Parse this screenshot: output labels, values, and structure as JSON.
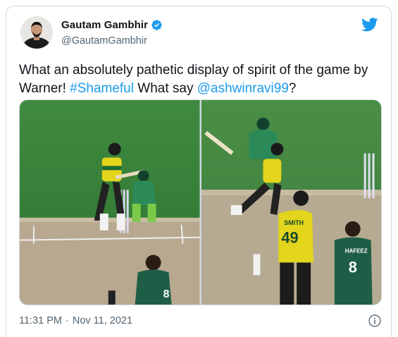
{
  "tweet": {
    "display_name": "Gautam Gambhir",
    "handle": "@GautamGambhir",
    "verified": true,
    "text_parts": [
      {
        "type": "text",
        "value": "What an absolutely pathetic display of spirit of the game by Warner! "
      },
      {
        "type": "hashtag",
        "value": "#Shameful"
      },
      {
        "type": "text",
        "value": " What say "
      },
      {
        "type": "mention",
        "value": "@ashwinravi99"
      },
      {
        "type": "text",
        "value": "?"
      }
    ],
    "time": "11:31 PM",
    "separator": "·",
    "date": "Nov 11, 2021"
  },
  "media": {
    "left_image": {
      "icon": "cricket-batsman-photo",
      "jersey_number_keeper": ""
    },
    "right_image": {
      "icon": "cricket-batsman-photo",
      "smith_name": "SMITH",
      "smith_number": "49",
      "hafeez_name": "HAFEEZ",
      "hafeez_number": "8",
      "left_bottom_number": "8"
    }
  },
  "colors": {
    "link": "#1d9bf0",
    "verified": "#1d9bf0",
    "twitter_logo": "#1d9bf0",
    "muted_text": "#536471",
    "border": "#cfd9de",
    "pitch_green": "#3c8a3c",
    "australia_yellow": "#e9d21a",
    "pakistan_green": "#1f5e46"
  }
}
